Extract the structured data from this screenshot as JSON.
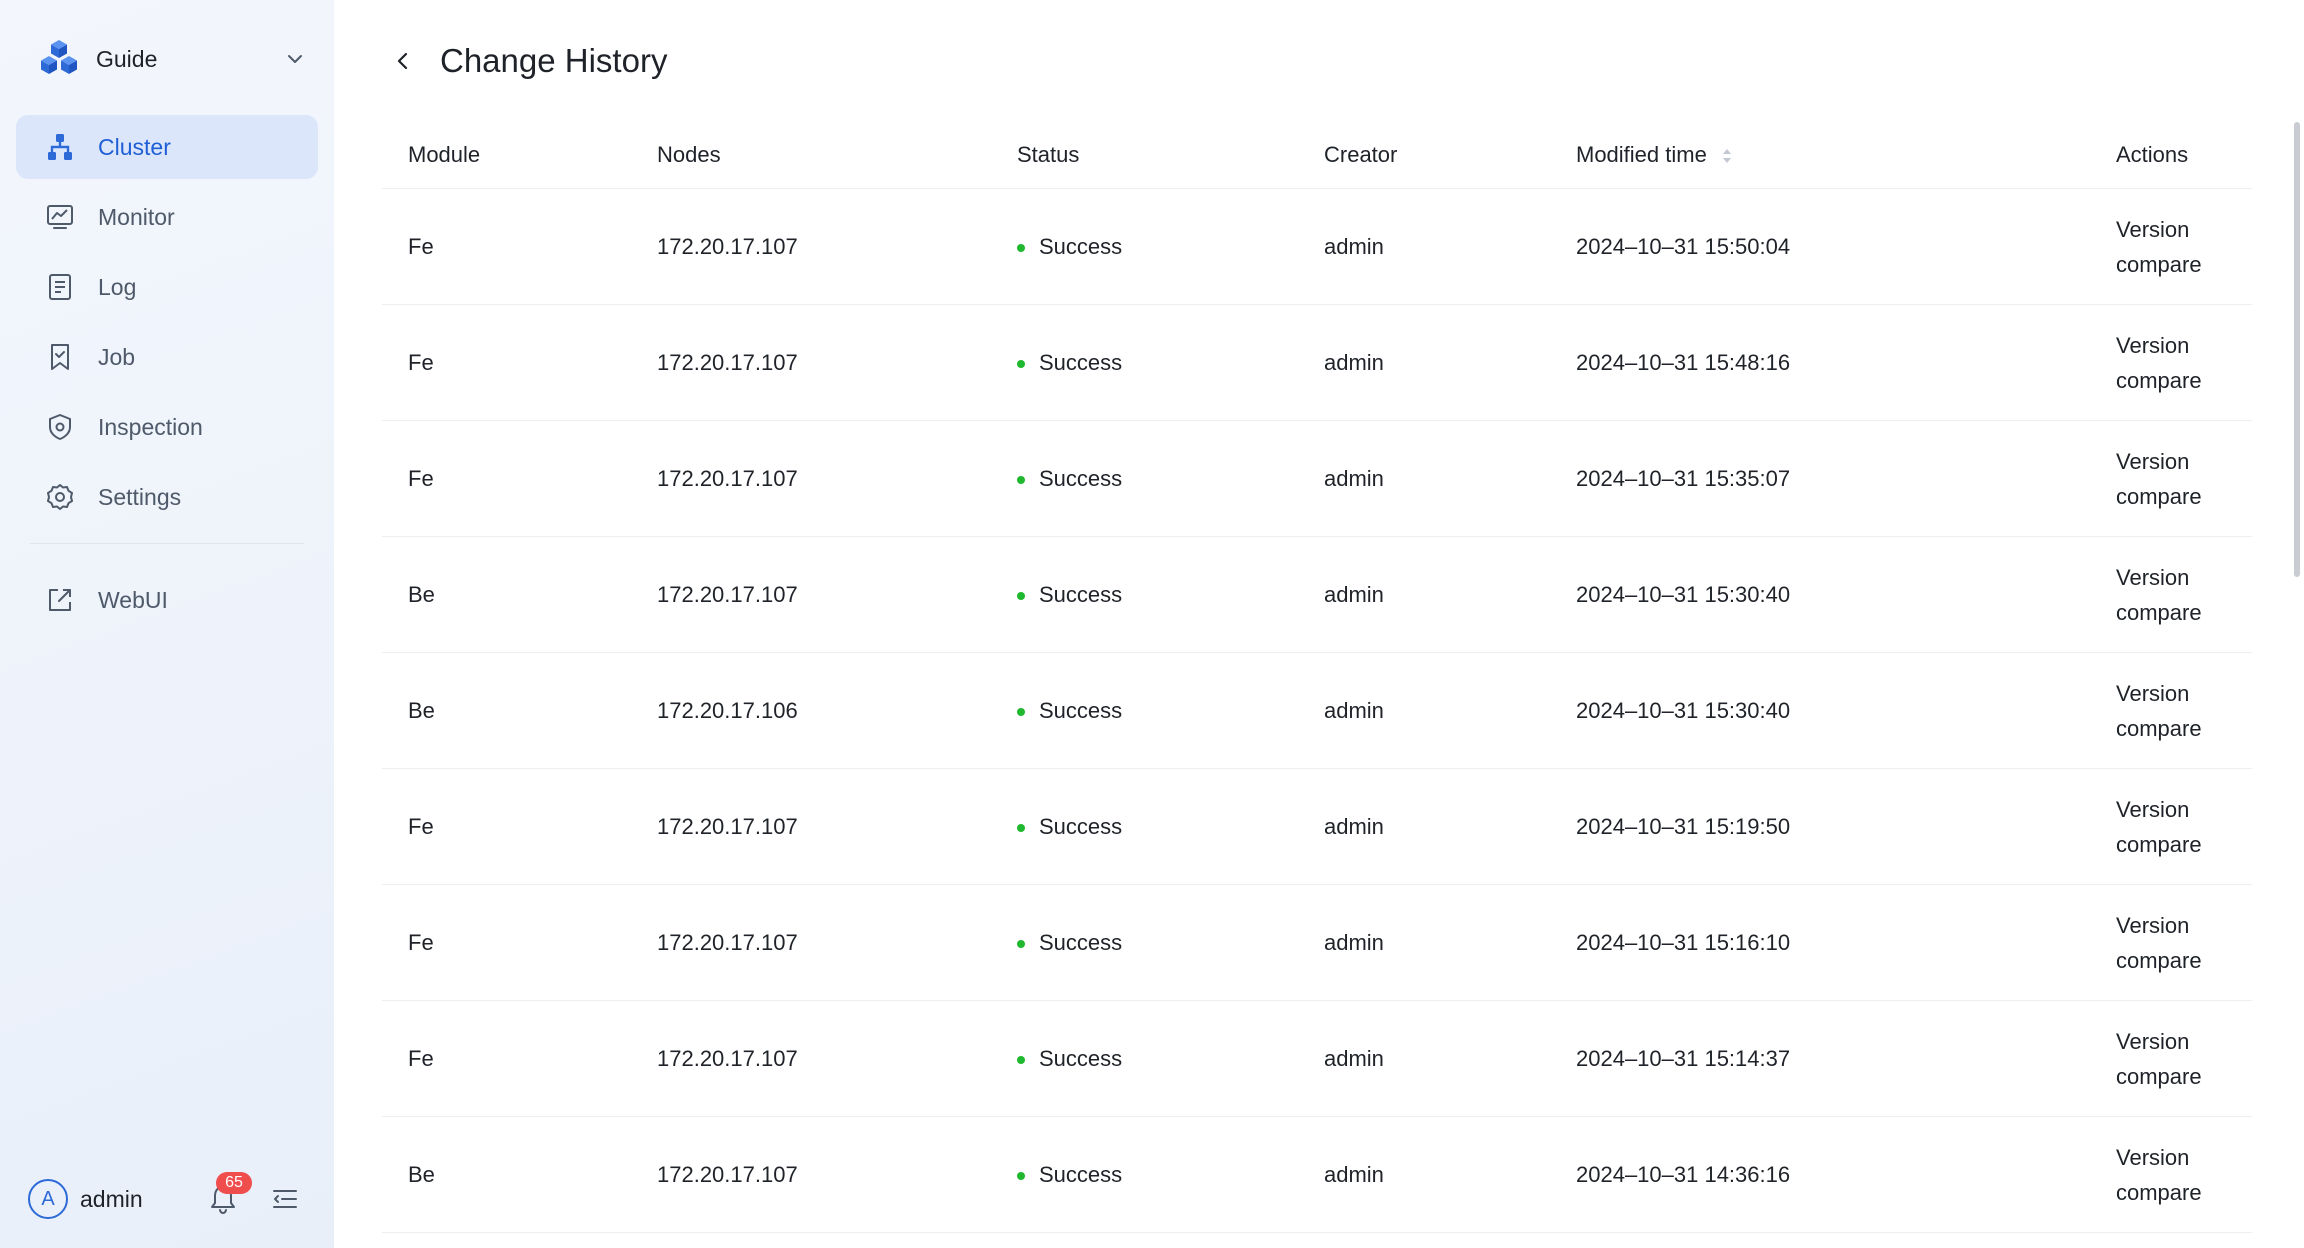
{
  "sidebar": {
    "brand": {
      "name": "Guide"
    },
    "nav": [
      {
        "label": "Cluster",
        "icon": "cluster-icon",
        "active": true
      },
      {
        "label": "Monitor",
        "icon": "monitor-icon"
      },
      {
        "label": "Log",
        "icon": "log-icon"
      },
      {
        "label": "Job",
        "icon": "job-icon"
      },
      {
        "label": "Inspection",
        "icon": "shield-icon"
      },
      {
        "label": "Settings",
        "icon": "gear-icon"
      }
    ],
    "external": {
      "label": "WebUI",
      "icon": "external-link-icon"
    },
    "user": {
      "avatar_letter": "A",
      "name": "admin"
    },
    "notifications": {
      "count": "65"
    }
  },
  "header": {
    "title": "Change History"
  },
  "table": {
    "columns": {
      "module": "Module",
      "nodes": "Nodes",
      "status": "Status",
      "creator": "Creator",
      "modified_time": "Modified time",
      "actions": "Actions"
    },
    "rows": [
      {
        "module": "Fe",
        "nodes": "172.20.17.107",
        "status": "Success",
        "creator": "admin",
        "time": "2024–10–31 15:50:04",
        "action": "Version compare"
      },
      {
        "module": "Fe",
        "nodes": "172.20.17.107",
        "status": "Success",
        "creator": "admin",
        "time": "2024–10–31 15:48:16",
        "action": "Version compare"
      },
      {
        "module": "Fe",
        "nodes": "172.20.17.107",
        "status": "Success",
        "creator": "admin",
        "time": "2024–10–31 15:35:07",
        "action": "Version compare"
      },
      {
        "module": "Be",
        "nodes": "172.20.17.107",
        "status": "Success",
        "creator": "admin",
        "time": "2024–10–31 15:30:40",
        "action": "Version compare"
      },
      {
        "module": "Be",
        "nodes": "172.20.17.106",
        "status": "Success",
        "creator": "admin",
        "time": "2024–10–31 15:30:40",
        "action": "Version compare"
      },
      {
        "module": "Fe",
        "nodes": "172.20.17.107",
        "status": "Success",
        "creator": "admin",
        "time": "2024–10–31 15:19:50",
        "action": "Version compare"
      },
      {
        "module": "Fe",
        "nodes": "172.20.17.107",
        "status": "Success",
        "creator": "admin",
        "time": "2024–10–31 15:16:10",
        "action": "Version compare"
      },
      {
        "module": "Fe",
        "nodes": "172.20.17.107",
        "status": "Success",
        "creator": "admin",
        "time": "2024–10–31 15:14:37",
        "action": "Version compare"
      },
      {
        "module": "Be",
        "nodes": "172.20.17.107",
        "status": "Success",
        "creator": "admin",
        "time": "2024–10–31 14:36:16",
        "action": "Version compare"
      }
    ]
  },
  "colors": {
    "accent": "#1f5fd6",
    "active_bg": "#dbe6fb",
    "success": "#1fb82f",
    "badge": "#f04d4d"
  }
}
